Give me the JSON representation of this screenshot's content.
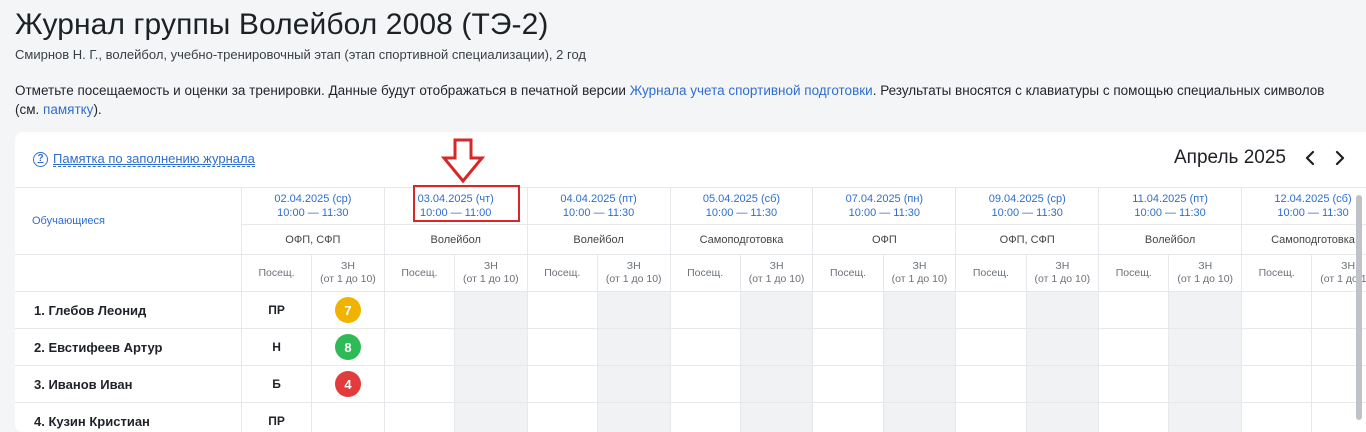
{
  "header": {
    "title": "Журнал группы Волейбол 2008 (ТЭ-2)",
    "subtitle": "Смирнов Н. Г., волейбол, учебно-тренировочный этап (этап спортивной специализации), 2 год"
  },
  "instructions": {
    "part1": "Отметьте посещаемость и оценки за тренировки. Данные будут отображаться в печатной версии ",
    "link1": "Журнала учета спортивной подготовки",
    "part2": ". Результаты вносятся с клавиатуры с помощью специальных символов (см. ",
    "link2": "памятку",
    "part3": ")."
  },
  "journal": {
    "memo_icon": "question-circle-icon",
    "memo_link": "Памятка по заполнению журнала",
    "month": "Апрель 2025",
    "prev_icon": "chevron-left-icon",
    "next_icon": "chevron-right-icon",
    "students_header": "Обучающиеся",
    "attendance_header": "Посещ.",
    "grade_header_line1": "ЗН",
    "grade_header_line2": "(от 1 до 10)",
    "sessions": [
      {
        "date": "02.04.2025 (ср)",
        "time": "10:00 — 11:30",
        "type": "ОФП, СФП"
      },
      {
        "date": "03.04.2025 (чт)",
        "time": "10:00 — 11:00",
        "type": "Волейбол"
      },
      {
        "date": "04.04.2025 (пт)",
        "time": "10:00 — 11:30",
        "type": "Волейбол"
      },
      {
        "date": "05.04.2025 (сб)",
        "time": "10:00 — 11:30",
        "type": "Самоподготовка"
      },
      {
        "date": "07.04.2025 (пн)",
        "time": "10:00 — 11:30",
        "type": "ОФП"
      },
      {
        "date": "09.04.2025 (ср)",
        "time": "10:00 — 11:30",
        "type": "ОФП, СФП"
      },
      {
        "date": "11.04.2025 (пт)",
        "time": "10:00 — 11:30",
        "type": "Волейбол"
      },
      {
        "date": "12.04.2025 (сб)",
        "time": "10:00 — 11:30",
        "type": "Самоподготовка"
      }
    ],
    "students": [
      {
        "name": "1. Глебов Леонид",
        "attendance": "ПР",
        "grade": "7",
        "grade_color": "#f0b400"
      },
      {
        "name": "2. Евстифеев Артур",
        "attendance": "Н",
        "grade": "8",
        "grade_color": "#2fba57"
      },
      {
        "name": "3. Иванов Иван",
        "attendance": "Б",
        "grade": "4",
        "grade_color": "#e33b3b"
      },
      {
        "name": "4. Кузин Кристиан",
        "attendance": "ПР",
        "grade": "",
        "grade_color": ""
      }
    ]
  },
  "annotation": {
    "arrow_icon": "down-arrow-outline-icon",
    "highlight_color": "#d92727"
  }
}
